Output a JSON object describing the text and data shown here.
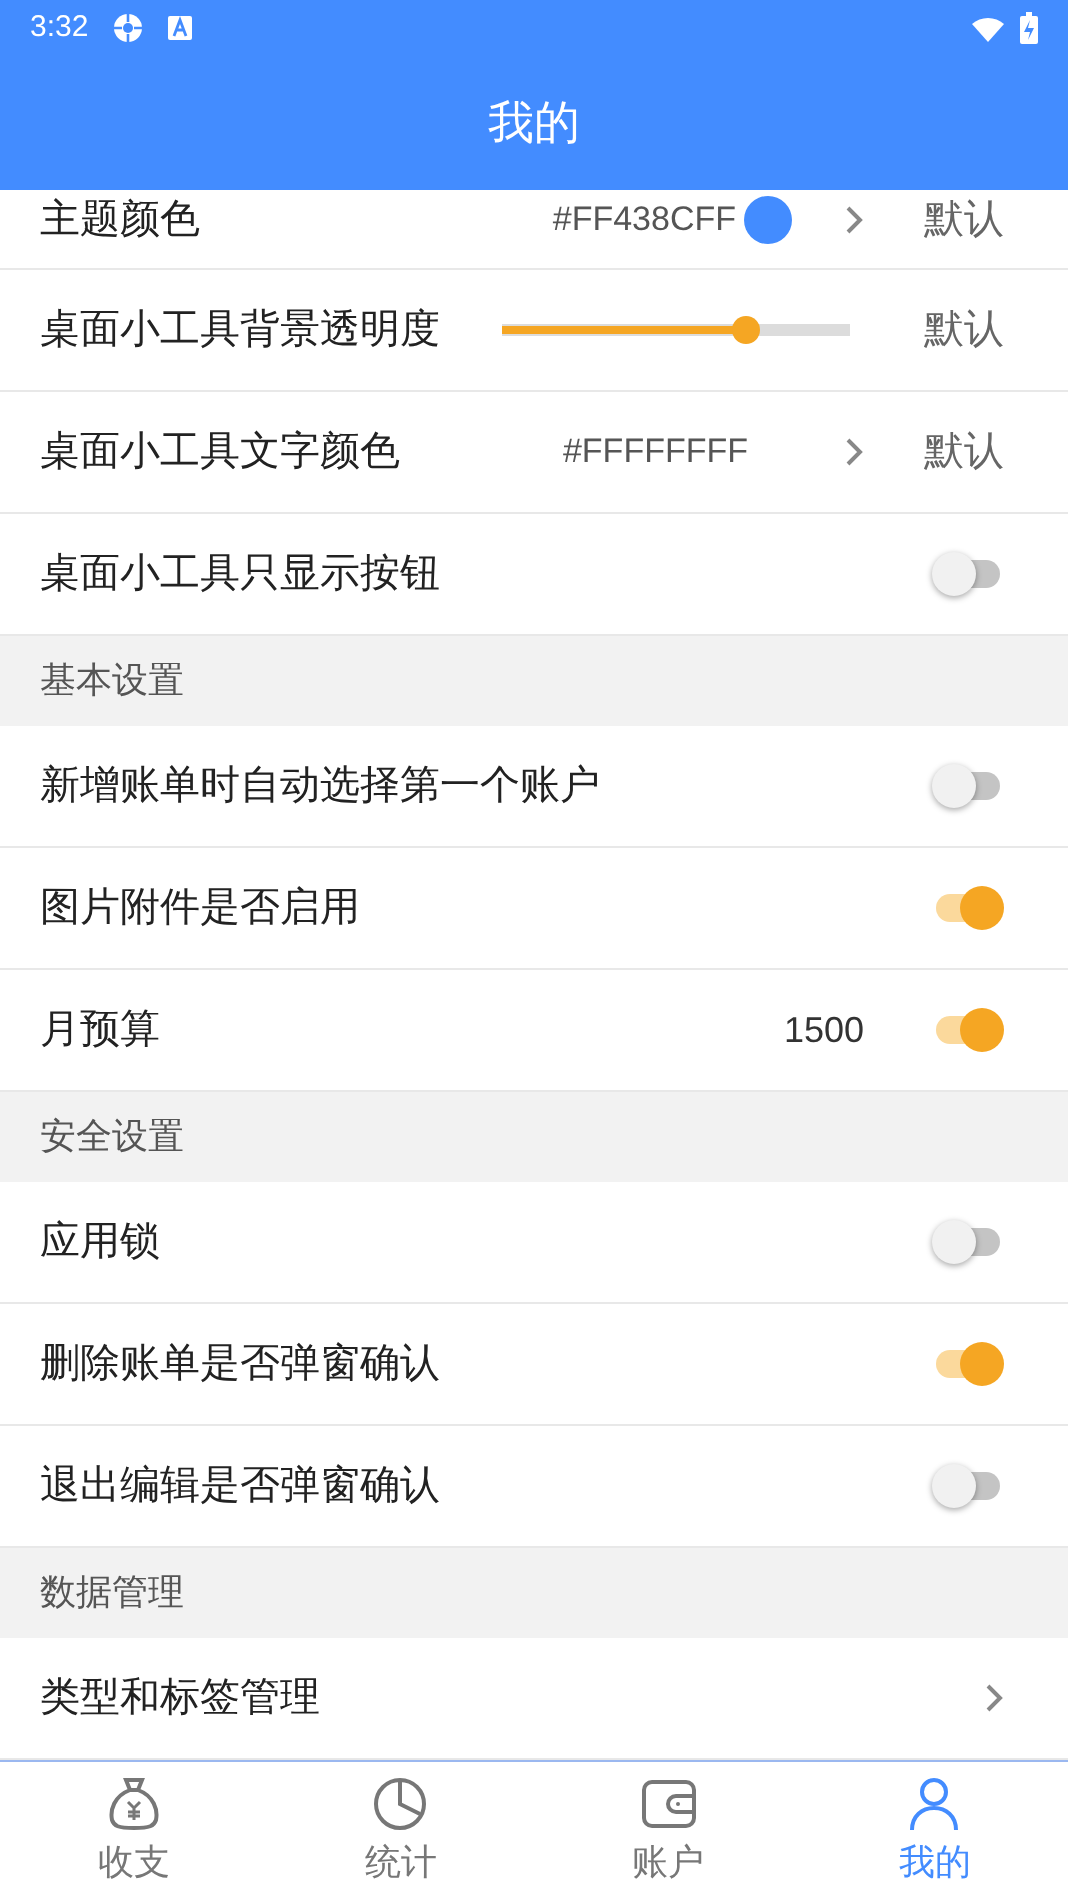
{
  "status_bar": {
    "time": "3:32"
  },
  "app_bar": {
    "title": "我的"
  },
  "sections": [
    {
      "items": [
        {
          "kind": "color",
          "label": "主题颜色",
          "value": "#FF438CFF",
          "color": "#438cff",
          "reset": "默认",
          "partial": true
        },
        {
          "kind": "slider",
          "label": "桌面小工具背景透明度",
          "level": 0.7,
          "reset": "默认"
        },
        {
          "kind": "color",
          "label": "桌面小工具文字颜色",
          "value": "#FFFFFFFF",
          "reset": "默认"
        },
        {
          "kind": "toggle",
          "label": "桌面小工具只显示按钮",
          "on": false
        }
      ]
    },
    {
      "header": "基本设置",
      "items": [
        {
          "kind": "toggle",
          "label": "新增账单时自动选择第一个账户",
          "on": false
        },
        {
          "kind": "toggle",
          "label": "图片附件是否启用",
          "on": true
        },
        {
          "kind": "toggle",
          "label": "月预算",
          "value": "1500",
          "on": true
        }
      ]
    },
    {
      "header": "安全设置",
      "items": [
        {
          "kind": "toggle",
          "label": "应用锁",
          "on": false
        },
        {
          "kind": "toggle",
          "label": "删除账单是否弹窗确认",
          "on": true
        },
        {
          "kind": "toggle",
          "label": "退出编辑是否弹窗确认",
          "on": false
        }
      ]
    },
    {
      "header": "数据管理",
      "items": [
        {
          "kind": "link",
          "label": "类型和标签管理"
        }
      ]
    }
  ],
  "bottom_nav": [
    {
      "kind": "money",
      "label": "收支",
      "selected": false
    },
    {
      "kind": "chart",
      "label": "统计",
      "selected": false
    },
    {
      "kind": "wallet",
      "label": "账户",
      "selected": false
    },
    {
      "kind": "person",
      "label": "我的",
      "selected": true
    }
  ]
}
